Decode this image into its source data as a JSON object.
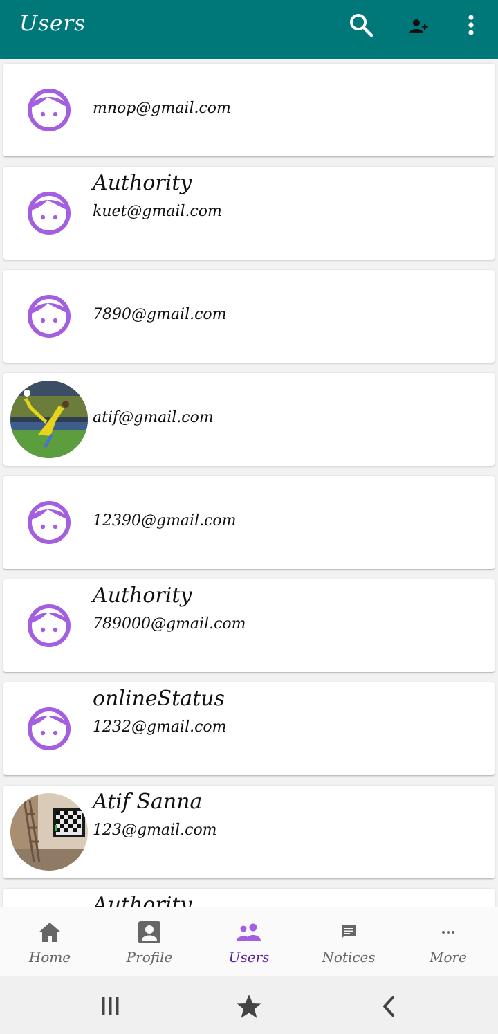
{
  "appbar": {
    "title": "Users",
    "background": "#00787a",
    "icons": [
      "search-icon",
      "add-user-icon",
      "more-vertical-icon"
    ]
  },
  "users": [
    {
      "name": "",
      "email": "mnop@gmail.com",
      "avatar": "default-face-icon"
    },
    {
      "name": "Authority",
      "email": "kuet@gmail.com",
      "avatar": "default-face-icon"
    },
    {
      "name": "",
      "email": "7890@gmail.com",
      "avatar": "default-face-icon"
    },
    {
      "name": "",
      "email": "atif@gmail.com",
      "avatar": "photo-football-player"
    },
    {
      "name": "",
      "email": "12390@gmail.com",
      "avatar": "default-face-icon"
    },
    {
      "name": "Authority",
      "email": "789000@gmail.com",
      "avatar": "default-face-icon"
    },
    {
      "name": "onlineStatus",
      "email": "1232@gmail.com",
      "avatar": "default-face-icon"
    },
    {
      "name": "Atif Sanna",
      "email": "123@gmail.com",
      "avatar": "photo-room-interior"
    },
    {
      "name": "Authority",
      "email": "",
      "avatar": "default-face-icon"
    }
  ],
  "avatar_color": "#a35fe0",
  "bottom_nav": {
    "items": [
      {
        "label": "Home",
        "icon": "home-icon"
      },
      {
        "label": "Profile",
        "icon": "profile-icon"
      },
      {
        "label": "Users",
        "icon": "users-icon"
      },
      {
        "label": "Notices",
        "icon": "notices-icon"
      },
      {
        "label": "More",
        "icon": "more-horizontal-icon"
      }
    ],
    "active": "Users",
    "active_color": "#5a1f9e"
  },
  "system_nav": [
    "recents-icon",
    "home-star-icon",
    "back-icon"
  ]
}
